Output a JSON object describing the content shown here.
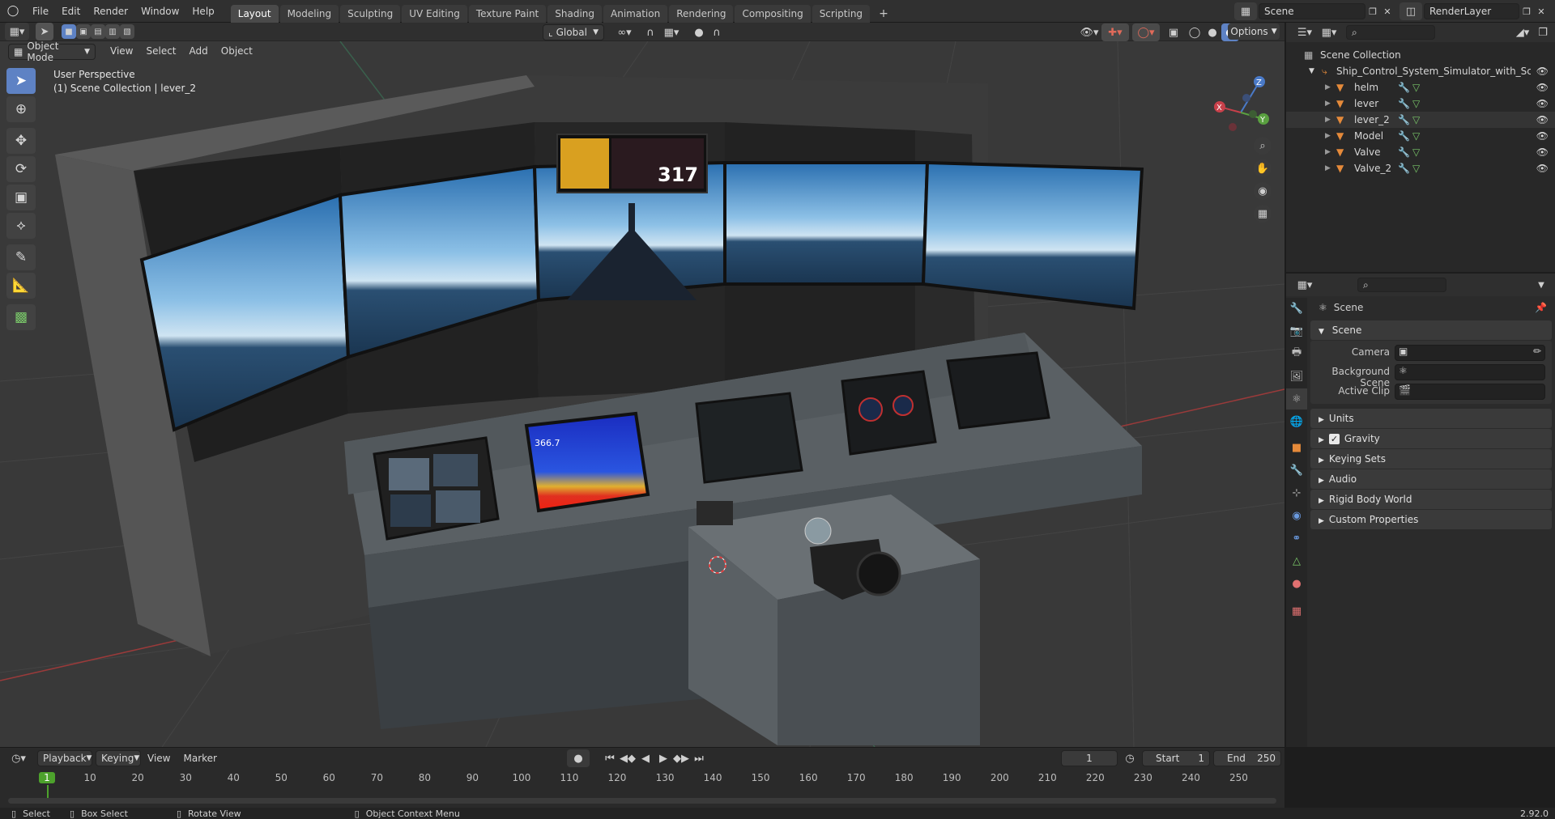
{
  "topbar": {
    "menus": [
      "File",
      "Edit",
      "Render",
      "Window",
      "Help"
    ],
    "workspaces": [
      "Layout",
      "Modeling",
      "Sculpting",
      "UV Editing",
      "Texture Paint",
      "Shading",
      "Animation",
      "Rendering",
      "Compositing",
      "Scripting"
    ],
    "active_workspace": "Layout",
    "add_tab": "+",
    "scene_name": "Scene",
    "view_layer": "RenderLayer"
  },
  "viewport_header": {
    "mode": "Object Mode",
    "menus": [
      "View",
      "Select",
      "Add",
      "Object"
    ],
    "transform_orientation": "Global",
    "options": "Options"
  },
  "viewport": {
    "view_name": "User Perspective",
    "collection_info": "(1) Scene Collection | lever_2",
    "screen_speed": "317",
    "sonar_depth": "366.7"
  },
  "outliner": {
    "root": "Scene Collection",
    "collection": "Ship_Control_System_Simulator_with_Screen",
    "objects": [
      "helm",
      "lever",
      "lever_2",
      "Model",
      "Valve",
      "Valve_2"
    ],
    "selected": "lever_2"
  },
  "properties": {
    "context": "Scene",
    "panel": "Scene",
    "fields": [
      {
        "label": "Camera"
      },
      {
        "label": "Background Scene"
      },
      {
        "label": "Active Clip"
      }
    ],
    "subpanels": [
      "Units",
      "Gravity",
      "Keying Sets",
      "Audio",
      "Rigid Body World",
      "Custom Properties"
    ],
    "gravity_checked": true
  },
  "timeline": {
    "menus": [
      "Playback",
      "Keying",
      "View",
      "Marker"
    ],
    "current_frame": "1",
    "start_label": "Start",
    "start": "1",
    "end_label": "End",
    "end": "250",
    "ticks": [
      "1",
      "10",
      "20",
      "30",
      "40",
      "50",
      "60",
      "70",
      "80",
      "90",
      "100",
      "110",
      "120",
      "130",
      "140",
      "150",
      "160",
      "170",
      "180",
      "190",
      "200",
      "210",
      "220",
      "230",
      "240",
      "250"
    ]
  },
  "statusbar": {
    "select": "Select",
    "box_select": "Box Select",
    "rotate_view": "Rotate View",
    "context_menu": "Object Context Menu",
    "version": "2.92.0"
  },
  "colors": {
    "accent": "#5e82c4",
    "object_icon": "#e58a3a",
    "current_frame": "#4da22c"
  }
}
